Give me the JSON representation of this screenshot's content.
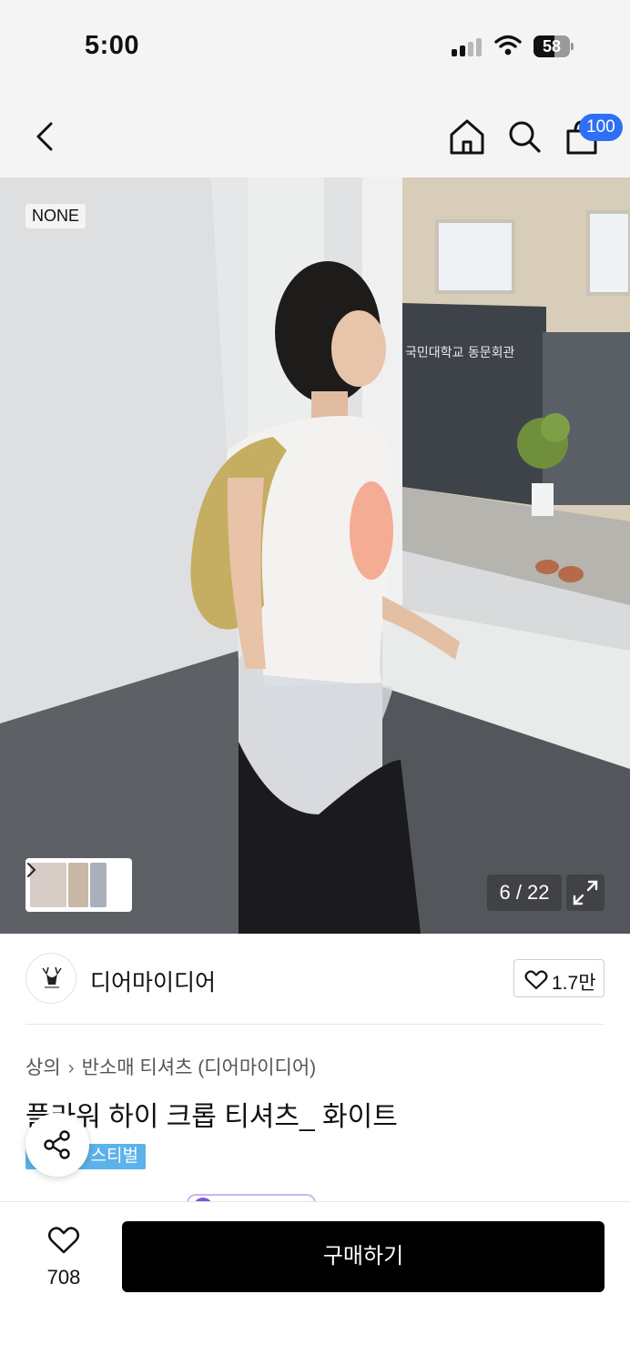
{
  "status_bar": {
    "time": "5:00",
    "battery_level": "58",
    "battery_fraction": 0.58
  },
  "nav": {
    "icons": [
      "back-arrow-icon",
      "home-icon",
      "search-icon",
      "shopping-bag-icon"
    ],
    "cart_count": "100",
    "cart_badge_color": "#2f6ff5"
  },
  "hero": {
    "brand_tag": "NONE",
    "sign_text": "국민대학교 동문회관",
    "image_counter": "6 / 22",
    "expand_icon": "expand-arrows-icon",
    "thumbnail_arrow_icon": "chevron-right-icon"
  },
  "brand": {
    "name": "디어마이디어",
    "like_count": "1.7만"
  },
  "product": {
    "breadcrumb": [
      "상의",
      "반소매 티셔츠 (디어마이디어)"
    ],
    "title": "플라워 하이 크롭 티셔츠_ 화이트",
    "badge": "스티벌",
    "badge_color": "#5cb2ea"
  },
  "bottom_bar": {
    "wishlist_count": "708",
    "buy_label": "구매하기"
  }
}
